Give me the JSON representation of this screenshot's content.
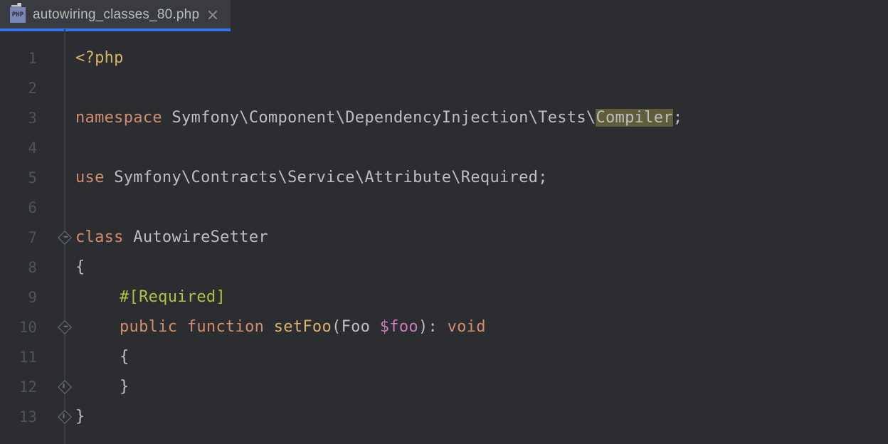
{
  "tab": {
    "filename": "autowiring_classes_80.php",
    "icon_label": "PHP"
  },
  "gutter": [
    "1",
    "2",
    "3",
    "4",
    "5",
    "6",
    "7",
    "8",
    "9",
    "10",
    "11",
    "12",
    "13"
  ],
  "code": {
    "l1_open": "<?php",
    "l3_kw": "namespace ",
    "l3_ns_a": "Symfony\\Component\\DependencyInjection\\Tests\\",
    "l3_ns_b": "Compiler",
    "l3_semi": ";",
    "l5_kw": "use ",
    "l5_ns": "Symfony\\Contracts\\Service\\Attribute\\Required",
    "l5_semi": ";",
    "l7_kw": "class ",
    "l7_name": "AutowireSetter",
    "l8_brace": "{",
    "l9_attr": "#[Required]",
    "l10_kw1": "public ",
    "l10_kw2": "function ",
    "l10_fn": "setFoo",
    "l10_paren_o": "(",
    "l10_type": "Foo ",
    "l10_var": "$foo",
    "l10_paren_c": ")",
    "l10_colon": ": ",
    "l10_ret": "void",
    "l11_brace": "{",
    "l12_brace": "}",
    "l13_brace": "}"
  }
}
